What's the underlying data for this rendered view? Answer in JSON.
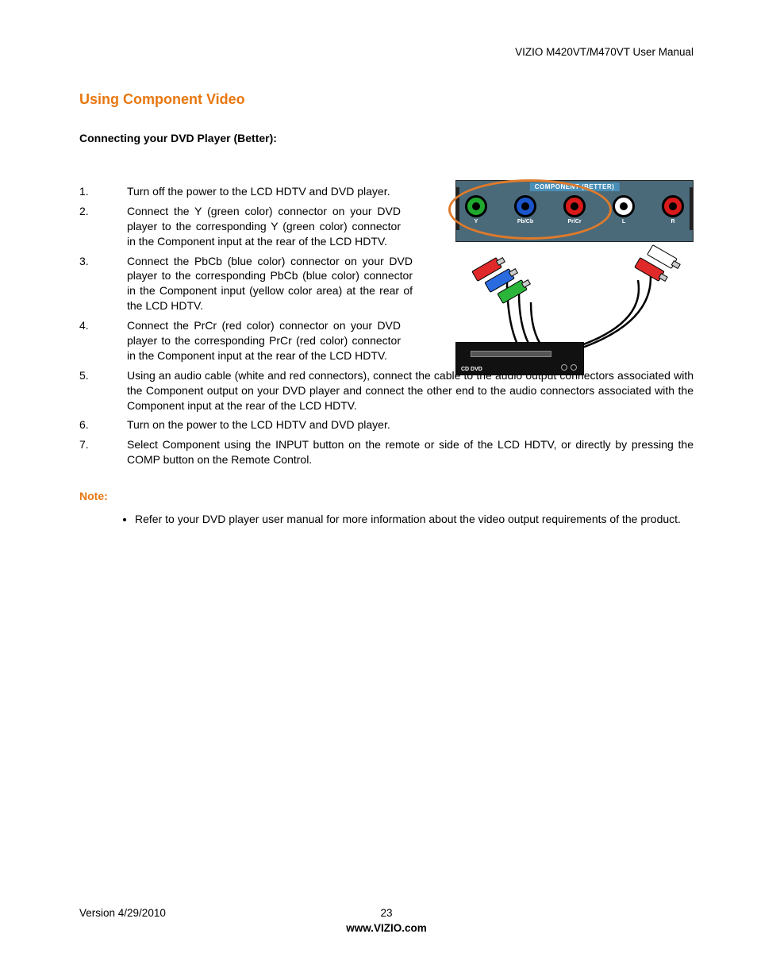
{
  "header": {
    "doctitle": "VIZIO M420VT/M470VT User Manual"
  },
  "section": {
    "title": "Using Component Video",
    "subhead": "Connecting your DVD Player (Better):"
  },
  "steps": [
    "Turn off the power to the LCD HDTV and DVD player.",
    "Connect the Y (green color) connector on your DVD player to the corresponding Y (green color) connector in the Component input at the rear of the LCD HDTV.",
    "Connect the PbCb (blue color) connector on your DVD player to the corresponding PbCb (blue color) connector in the Component input (yellow color area) at the rear of the LCD HDTV.",
    "Connect the PrCr (red color) connector on your DVD player to the corresponding PrCr (red color) connector in the Component input at the rear of the LCD HDTV.",
    "Using an audio cable (white and red connectors), connect the cable to the audio output connectors associated with the Component output on your DVD player and connect the other end to the audio connectors associated with the Component input  at the rear of the LCD HDTV.",
    "Turn on the power to the LCD HDTV and DVD player.",
    "Select Component using the INPUT button on the remote or side of the LCD HDTV, or directly by pressing the COMP button on the Remote Control."
  ],
  "note": {
    "label": "Note:",
    "items": [
      "Refer to your DVD player user manual for more information about the video output requirements of the product."
    ]
  },
  "figure": {
    "panel_label": "COMPONENT (BETTER)",
    "jacks": {
      "y": "Y",
      "pb": "Pb/Cb",
      "pr": "Pr/Cr",
      "l": "L",
      "r": "R"
    },
    "dvd_label": "CD DVD"
  },
  "footer": {
    "version": "Version 4/29/2010",
    "page": "23",
    "url": "www.VIZIO.com"
  }
}
